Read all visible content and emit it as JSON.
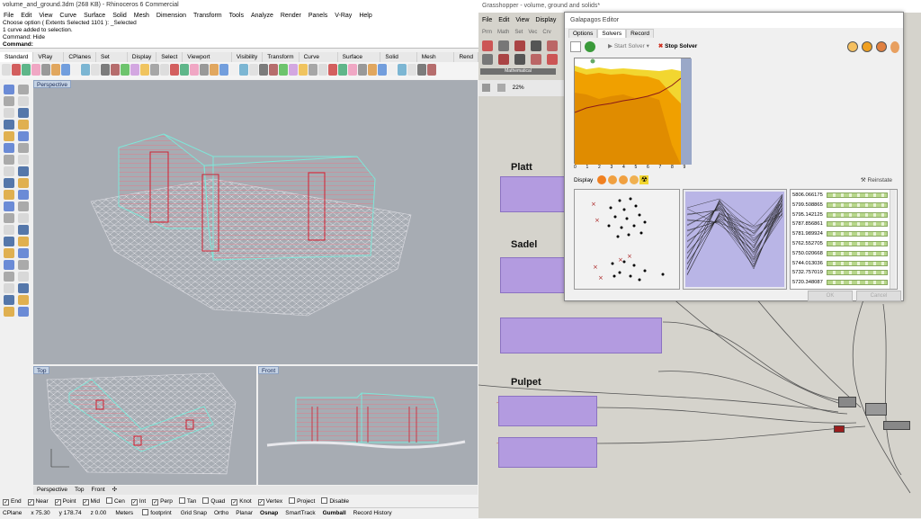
{
  "rhino": {
    "title": "volume_and_ground.3dm (268 KB) - Rhinoceros 6 Commercial",
    "menu": [
      "File",
      "Edit",
      "View",
      "Curve",
      "Surface",
      "Solid",
      "Mesh",
      "Dimension",
      "Transform",
      "Tools",
      "Analyze",
      "Render",
      "Panels",
      "V-Ray",
      "Help"
    ],
    "command_lines": [
      "Choose option ( Extents  Selected  1101 ): _Selected",
      "1 curve added to selection.",
      "Command: Hide"
    ],
    "command_prompt": "Command:",
    "tabs": [
      "Standard",
      "VRay All",
      "CPlanes",
      "Set View",
      "Display",
      "Select",
      "Viewport Layout",
      "Visibility",
      "Transform",
      "Curve Tools",
      "Surface Tools",
      "Solid Tools",
      "Mesh Tools",
      "Rend"
    ],
    "viewports": {
      "perspective": "Perspective",
      "top": "Top",
      "front": "Front"
    },
    "viewport_tabs": [
      "Perspective",
      "Top",
      "Front",
      "✣"
    ],
    "osnap": [
      {
        "label": "End",
        "checked": true
      },
      {
        "label": "Near",
        "checked": true
      },
      {
        "label": "Point",
        "checked": true
      },
      {
        "label": "Mid",
        "checked": true
      },
      {
        "label": "Cen",
        "checked": false
      },
      {
        "label": "Int",
        "checked": true
      },
      {
        "label": "Perp",
        "checked": true
      },
      {
        "label": "Tan",
        "checked": false
      },
      {
        "label": "Quad",
        "checked": false
      },
      {
        "label": "Knot",
        "checked": true
      },
      {
        "label": "Vertex",
        "checked": true
      },
      {
        "label": "Project",
        "checked": false
      },
      {
        "label": "Disable",
        "checked": false
      }
    ],
    "status": {
      "cplane": "CPlane",
      "x": "x 75.30",
      "y": "y 178.74",
      "z": "z 0.00",
      "units": "Meters",
      "layer": "footprint",
      "toggles": [
        "Grid Snap",
        "Ortho",
        "Planar",
        "Osnap",
        "SmartTrack",
        "Gumball",
        "Record History"
      ]
    }
  },
  "gh": {
    "title": "Grasshopper - volume, ground and solids*",
    "menu": [
      "File",
      "Edit",
      "View",
      "Display"
    ],
    "tabs": [
      "Prm",
      "Math",
      "Set",
      "Vec",
      "Crv"
    ],
    "tool_caption": "Mathematical",
    "zoom": "22%",
    "groups": [
      "Platt",
      "Sadel",
      "Pulpet"
    ]
  },
  "galapagos": {
    "title": "Galapagos Editor",
    "tabs": [
      "Options",
      "Solvers",
      "Record"
    ],
    "start_solver": "Start Solver",
    "stop_solver": "Stop Solver",
    "display_label": "Display",
    "reinstate": "Reinstate",
    "x_ticks": [
      "0",
      "1",
      "2",
      "3",
      "4",
      "5",
      "6",
      "7",
      "8",
      "9"
    ],
    "fitness_values": [
      "5806.066175",
      "5799.508865",
      "5795.142125",
      "5787.856861",
      "5781.989924",
      "5762.552705",
      "5750.020668",
      "5744.013036",
      "5732.757019",
      "5720.348087"
    ],
    "ok": "OK",
    "cancel": "Cancel",
    "colors": {
      "orange": "#f0a000",
      "yellow": "#f2d630",
      "purple": "#b39be0"
    }
  }
}
